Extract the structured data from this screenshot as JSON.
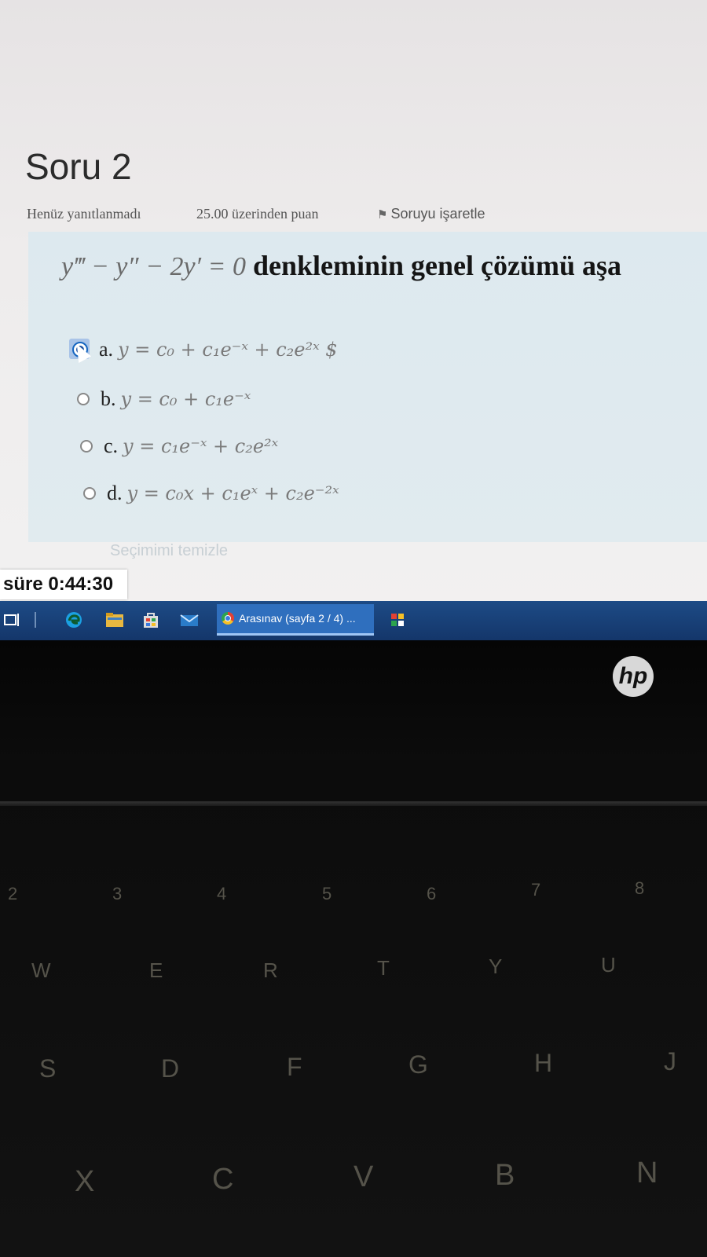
{
  "question": {
    "title": "Soru 2",
    "status": "Henüz yanıtlanmadı",
    "points": "25.00 üzerinden puan",
    "flag_label": "Soruyu işaretle",
    "text_math": "y‴ − y″ − 2y′ = 0",
    "text_rest": " denkleminin genel çözümü aşa",
    "options": [
      {
        "label": "a.",
        "math": "y = c₀ + c₁e⁻ˣ + c₂e²ˣ $",
        "selected": true
      },
      {
        "label": "b.",
        "math": "y = c₀ + c₁e⁻ˣ",
        "selected": false
      },
      {
        "label": "c.",
        "math": "y = c₁e⁻ˣ + c₂e²ˣ",
        "selected": false
      },
      {
        "label": "d.",
        "math": "y = c₀x + c₁eˣ + c₂e⁻²ˣ",
        "selected": false
      }
    ],
    "clear_selection": "Seçimimi temizle"
  },
  "timer": {
    "label": "süre 0:44:30"
  },
  "taskbar": {
    "active_window_title": "Arasınav (sayfa 2 / 4) ...",
    "icons": [
      "task-view-icon",
      "edge-icon",
      "file-explorer-icon",
      "store-icon",
      "mail-icon",
      "chrome-icon",
      "other-app-icon"
    ]
  },
  "laptop": {
    "brand": "hp",
    "keys": [
      "2",
      "3",
      "4",
      "5",
      "6",
      "7",
      "8",
      "W",
      "E",
      "R",
      "T",
      "Y",
      "U",
      "S",
      "D",
      "F",
      "G",
      "H",
      "J",
      "X",
      "C",
      "V",
      "B",
      "N"
    ]
  },
  "colors": {
    "taskbar": "#1d4b86",
    "question_box": "#dde9ef",
    "radio_selected": "#1a4fa0"
  }
}
